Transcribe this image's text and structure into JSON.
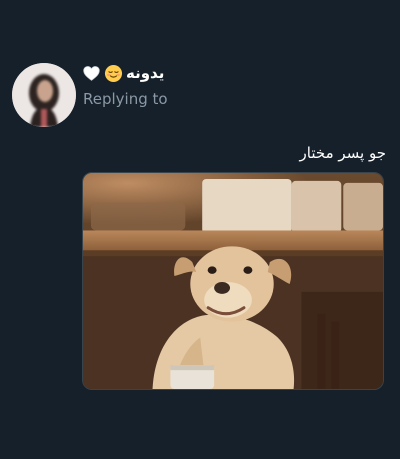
{
  "reply": {
    "display_name": "یدونه",
    "name_emojis": [
      "relieved-face-emoji",
      "white-heart-emoji"
    ],
    "replying_label": "Replying to",
    "text": "جو پسر مختار",
    "media": {
      "type": "image",
      "subject": "dog-photo"
    }
  },
  "colors": {
    "background": "#15202b",
    "primary_text": "#ffffff",
    "secondary_text": "#8b98a5"
  }
}
